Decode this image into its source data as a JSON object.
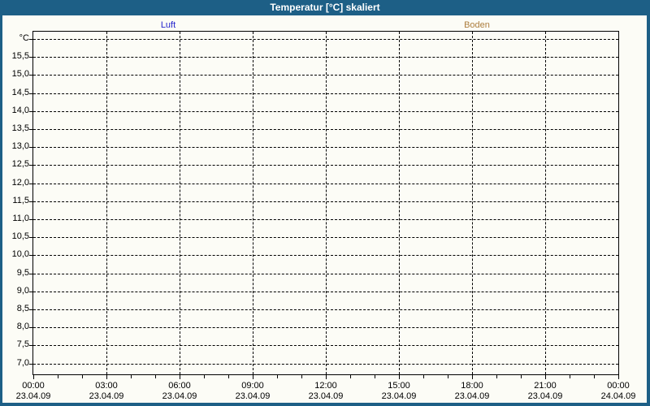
{
  "title": "Temperatur [°C] skaliert",
  "colors": {
    "frame": "#1d5f86",
    "title_text": "#ffffff",
    "background": "#fcfcf6",
    "plot_border": "#000000",
    "grid": "#000000",
    "luft": "#2222cc",
    "boden": "#ad7d3d"
  },
  "chart_data": {
    "type": "line",
    "title": "Temperatur [°C] skaliert",
    "grid": {
      "style": "dashed",
      "color": "#000000",
      "on": true
    },
    "y_axis": {
      "unit_label": "°C",
      "unit_line_value": 16.0,
      "tick_labels": [
        "15,5",
        "15,0",
        "14,5",
        "14,0",
        "13,5",
        "13,0",
        "12,5",
        "12,0",
        "11,5",
        "11,0",
        "10,5",
        "10,0",
        "9,5",
        "9,0",
        "8,5",
        "8,0",
        "7,5",
        "7,0"
      ],
      "tick_values": [
        15.5,
        15.0,
        14.5,
        14.0,
        13.5,
        13.0,
        12.5,
        12.0,
        11.5,
        11.0,
        10.5,
        10.0,
        9.5,
        9.0,
        8.5,
        8.0,
        7.5,
        7.0
      ],
      "tick_step": 0.5,
      "range_shown": [
        6.7,
        16.2
      ]
    },
    "x_axis": {
      "tick_hours": [
        0,
        3,
        6,
        9,
        12,
        15,
        18,
        21,
        24
      ],
      "minor_tick_interval_hours": 1,
      "ticks": [
        {
          "time": "00:00",
          "date": "23.04.09"
        },
        {
          "time": "03:00",
          "date": "23.04.09"
        },
        {
          "time": "06:00",
          "date": "23.04.09"
        },
        {
          "time": "09:00",
          "date": "23.04.09"
        },
        {
          "time": "12:00",
          "date": "23.04.09"
        },
        {
          "time": "15:00",
          "date": "23.04.09"
        },
        {
          "time": "18:00",
          "date": "23.04.09"
        },
        {
          "time": "21:00",
          "date": "23.04.09"
        },
        {
          "time": "00:00",
          "date": "24.04.09"
        }
      ]
    },
    "series": [
      {
        "name": "Luft",
        "color": "#2222cc",
        "values": []
      },
      {
        "name": "Boden",
        "color": "#ad7d3d",
        "values": []
      }
    ],
    "legend_position": "top"
  }
}
